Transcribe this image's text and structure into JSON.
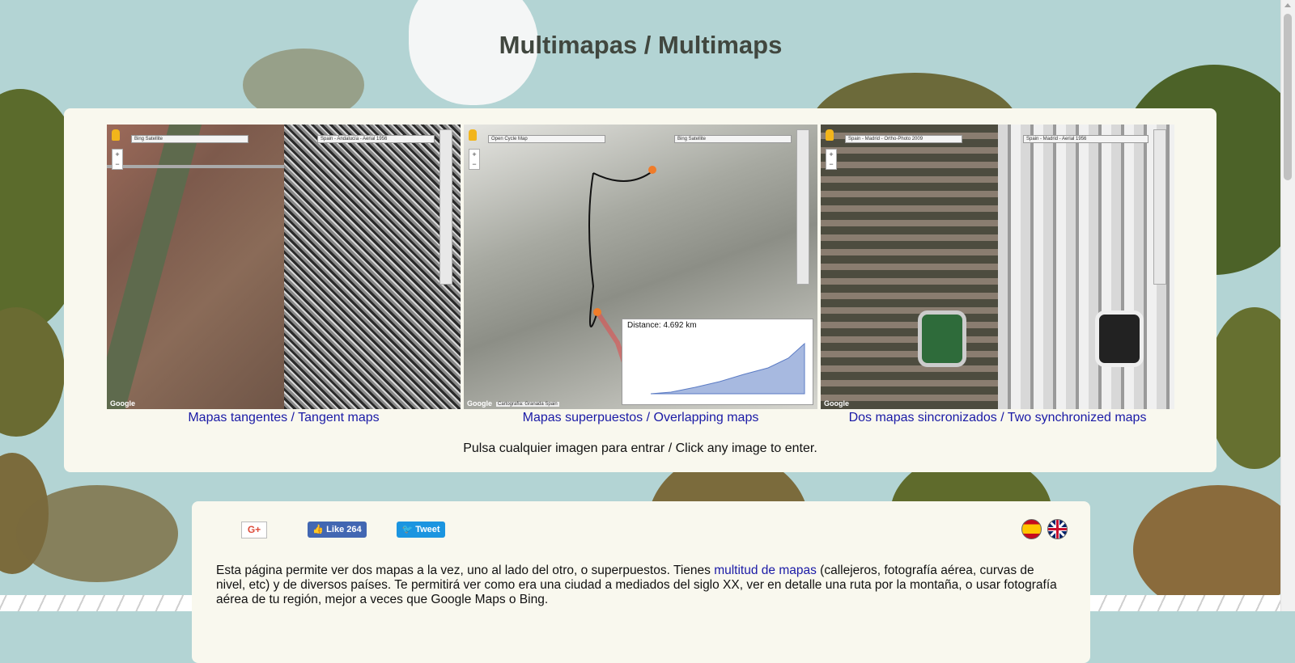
{
  "page": {
    "title": "Multimapas / Multimaps"
  },
  "gallery": {
    "items": [
      {
        "caption": "Mapas tangentes / Tangent maps",
        "left_select": "Bing Satellite",
        "right_select": "Spain - Andalucía - Aerial 1956"
      },
      {
        "caption": "Mapas superpuestos / Overlapping maps",
        "left_select": "Open Cycle Map",
        "right_select": "Bing Satellite",
        "distance_label": "Distance: 4.692 km",
        "attribution": "Cartografía: Granada Spain"
      },
      {
        "caption": "Dos mapas sincronizados / Two synchronized maps",
        "left_select": "Spain - Madrid - Ortho-Photo 2009",
        "right_select": "Spain - Madrid - Aerial 1956"
      }
    ],
    "google_label": "Google",
    "hint": "Pulsa cualquier imagen para entrar / Click any image to enter."
  },
  "social": {
    "gplus": "G+",
    "facebook": "Like 264",
    "twitter": "Tweet"
  },
  "languages": {
    "es_icon": "spain-flag-icon",
    "en_icon": "uk-flag-icon"
  },
  "intro": {
    "part1": "Esta página permite ver dos mapas a la vez, uno al lado del otro, o superpuestos. Tienes ",
    "link": "multitud de mapas",
    "part2": " (callejeros, fotografía aérea, curvas de nivel, etc) y de diversos países. Te permitirá ver como era una ciudad a mediados del siglo XX, ver en detalle una ruta por la montaña, o usar fotografía aérea de tu región, mejor a veces que Google Maps o Bing."
  }
}
